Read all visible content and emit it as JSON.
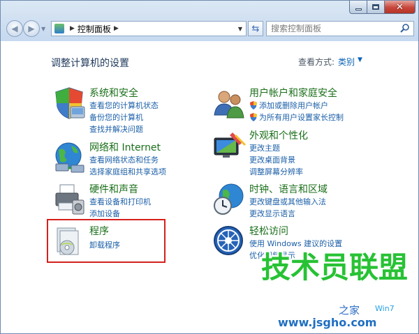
{
  "window": {
    "breadcrumb": "控制面板",
    "search_placeholder": "搜索控制面板"
  },
  "header": {
    "title": "调整计算机的设置",
    "view_by_label": "查看方式:",
    "view_by_value": "类别"
  },
  "categories": [
    {
      "title": "系统和安全",
      "links": [
        "查看您的计算机状态",
        "备份您的计算机",
        "查找并解决问题"
      ],
      "icon": "shield-icon"
    },
    {
      "title": "网络和 Internet",
      "links": [
        "查看网络状态和任务",
        "选择家庭组和共享选项"
      ],
      "icon": "network-globe-icon"
    },
    {
      "title": "硬件和声音",
      "links": [
        "查看设备和打印机",
        "添加设备"
      ],
      "icon": "printer-icon"
    },
    {
      "title": "程序",
      "links": [
        "卸载程序"
      ],
      "icon": "programs-icon"
    },
    {
      "title": "用户帐户和家庭安全",
      "links": [
        "添加或删除用户帐户",
        "为所有用户设置家长控制"
      ],
      "icon": "users-icon"
    },
    {
      "title": "外观和个性化",
      "links": [
        "更改主题",
        "更改桌面背景",
        "调整屏幕分辨率"
      ],
      "icon": "display-icon"
    },
    {
      "title": "时钟、语言和区域",
      "links": [
        "更改键盘或其他输入法",
        "更改显示语言"
      ],
      "icon": "clock-globe-icon"
    },
    {
      "title": "轻松访问",
      "links": [
        "使用 Windows 建议的设置",
        "优化视频显示"
      ],
      "icon": "ease-of-access-icon"
    }
  ],
  "watermark": {
    "main": "技术员联盟",
    "url": "www.jsgho.com",
    "tag": "之家",
    "win": "Win7"
  }
}
